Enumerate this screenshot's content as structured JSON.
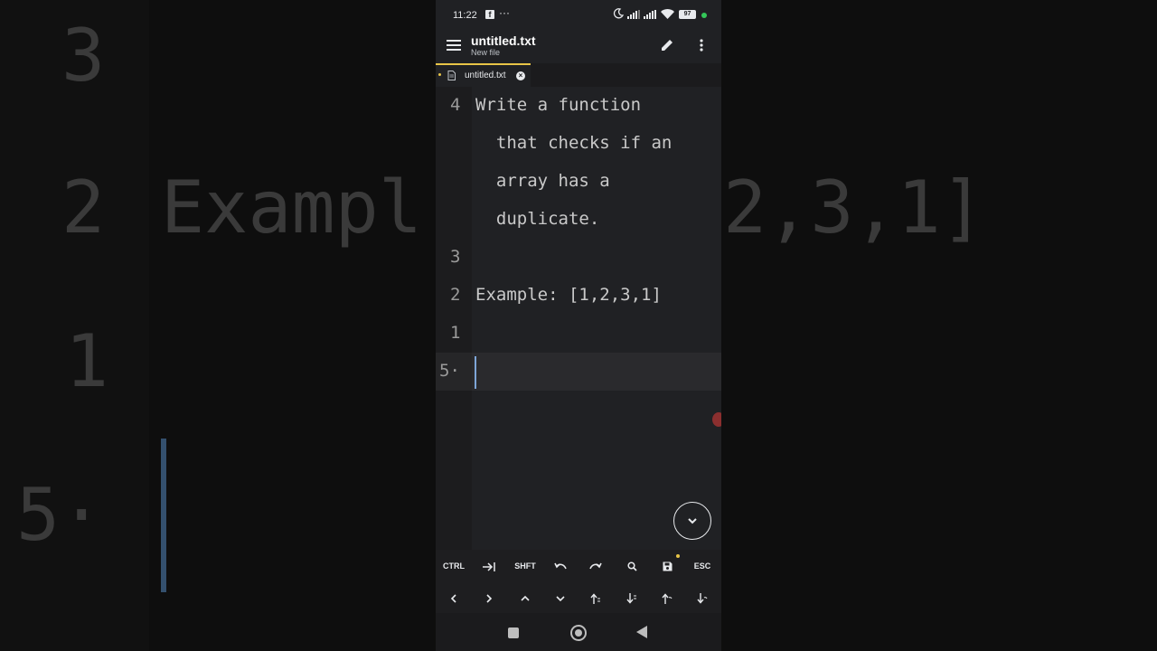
{
  "background": {
    "lines": [
      {
        "num": "3",
        "text": ""
      },
      {
        "num": "2",
        "text": "Exampl"
      },
      {
        "num": "",
        "text": "2,3,1]"
      },
      {
        "num": "1",
        "text": ""
      },
      {
        "num": "5·",
        "text": ""
      }
    ]
  },
  "status_bar": {
    "time": "11:22",
    "more": "···",
    "battery": "97"
  },
  "app_bar": {
    "title": "untitled.txt",
    "subtitle": "New file"
  },
  "tab": {
    "label": "untitled.txt"
  },
  "editor": {
    "lines": [
      {
        "num": "4",
        "text": "Write a function"
      },
      {
        "num": "",
        "text": "  that checks if an"
      },
      {
        "num": "",
        "text": "  array has a"
      },
      {
        "num": "",
        "text": "  duplicate."
      },
      {
        "num": "3",
        "text": ""
      },
      {
        "num": "2",
        "text": "Example: [1,2,3,1]"
      },
      {
        "num": "1",
        "text": ""
      },
      {
        "num": "5·",
        "text": ""
      }
    ]
  },
  "keys": {
    "row1": [
      "CTRL",
      "tab-icon",
      "SHFT",
      "undo-icon",
      "redo-icon",
      "search-icon",
      "save-icon",
      "ESC"
    ],
    "ctrl": "CTRL",
    "shft": "SHFT",
    "esc": "ESC"
  },
  "colors": {
    "accent": "#e8c547",
    "cursor": "#7ea6d8",
    "background": "#202124"
  }
}
